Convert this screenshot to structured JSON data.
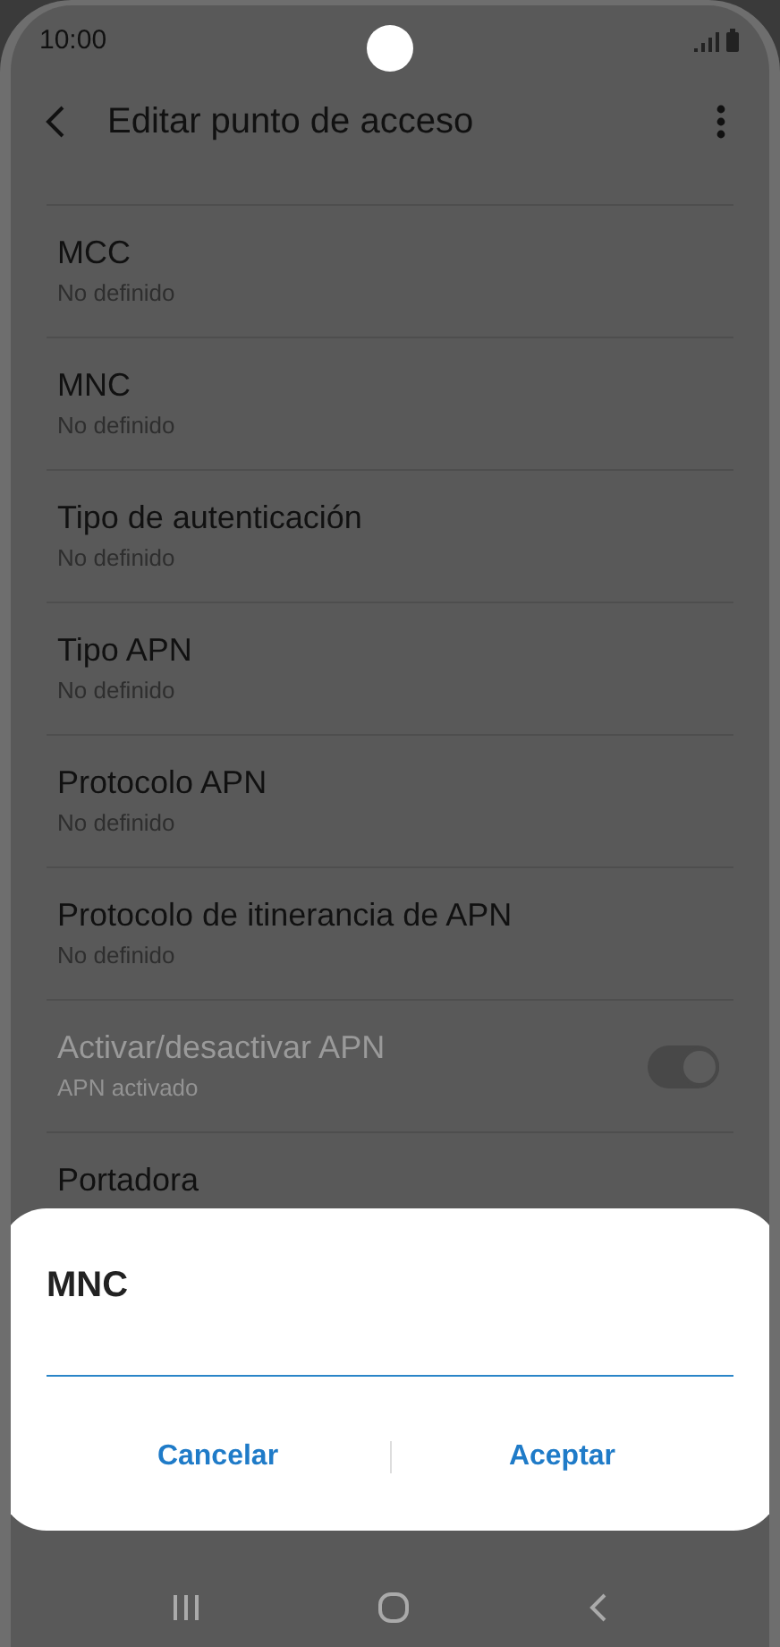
{
  "status_bar": {
    "time": "10:00"
  },
  "header": {
    "title": "Editar punto de acceso"
  },
  "settings": [
    {
      "kind": "text",
      "title": "MCC",
      "subtitle": "No definido",
      "disabled": false
    },
    {
      "kind": "text",
      "title": "MNC",
      "subtitle": "No definido",
      "disabled": false
    },
    {
      "kind": "text",
      "title": "Tipo de autenticación",
      "subtitle": "No definido",
      "disabled": false
    },
    {
      "kind": "text",
      "title": "Tipo APN",
      "subtitle": "No definido",
      "disabled": false
    },
    {
      "kind": "text",
      "title": "Protocolo APN",
      "subtitle": "No definido",
      "disabled": false
    },
    {
      "kind": "text",
      "title": "Protocolo de itinerancia de APN",
      "subtitle": "No definido",
      "disabled": false
    },
    {
      "kind": "switch",
      "title": "Activar/desactivar APN",
      "subtitle": "APN activado",
      "disabled": true,
      "on": true
    },
    {
      "kind": "text",
      "title": "Portadora",
      "disabled": false
    }
  ],
  "dialog": {
    "title": "MNC",
    "buttons": [
      "Cancelar",
      "Aceptar"
    ]
  }
}
